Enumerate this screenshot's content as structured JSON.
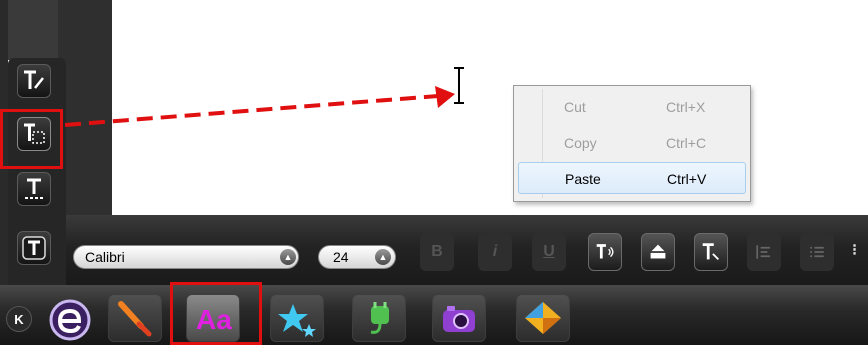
{
  "context_menu": {
    "items": [
      {
        "label": "Cut",
        "shortcut": "Ctrl+X",
        "enabled": false
      },
      {
        "label": "Copy",
        "shortcut": "Ctrl+C",
        "enabled": false
      },
      {
        "label": "Paste",
        "shortcut": "Ctrl+V",
        "enabled": true,
        "hovered": true
      }
    ]
  },
  "text_tools": [
    "text-edit-icon",
    "text-box-icon",
    "text-underline-tool-icon",
    "text-style-icon"
  ],
  "format_bar": {
    "font_family": "Calibri",
    "font_size": "24",
    "bold_label": "B",
    "italic_label": "i",
    "underline_label": "U",
    "buttons": [
      "text-speak-icon",
      "text-fill-icon",
      "clear-format-icon",
      "align-icon",
      "list-icon"
    ]
  },
  "dock": {
    "back_label": "K",
    "apps": [
      "browser-e-icon",
      "paint-brush-icon",
      "text-aa-icon",
      "stars-effects-icon",
      "plugin-icon",
      "camera-icon",
      "shapes-icon"
    ],
    "active_app": "text-aa-icon"
  },
  "colors": {
    "annotation_red": "#e01010",
    "menu_hover": "#dcebfa",
    "text_app_accent": "#e020e0"
  }
}
